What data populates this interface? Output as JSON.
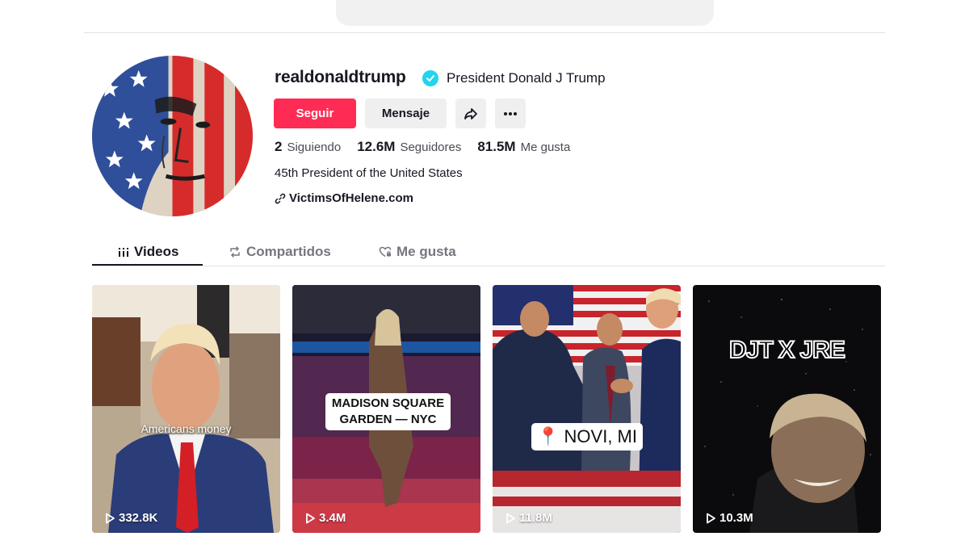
{
  "profile": {
    "username": "realdonaldtrump",
    "nickname": "President Donald J Trump",
    "bio": "45th President of the United States",
    "link": "VictimsOfHelene.com",
    "verified_icon": "verified-check-icon"
  },
  "actions": {
    "follow_label": "Seguir",
    "message_label": "Mensaje",
    "share_icon": "share-icon",
    "more_icon": "more-dots-icon"
  },
  "stats": {
    "following_count": "2",
    "following_label": "Siguiendo",
    "followers_count": "12.6M",
    "followers_label": "Seguidores",
    "likes_count": "81.5M",
    "likes_label": "Me gusta"
  },
  "tabs": [
    {
      "label": "Videos",
      "icon": "grid-icon",
      "active": true
    },
    {
      "label": "Compartidos",
      "icon": "repost-icon",
      "active": false
    },
    {
      "label": "Me gusta",
      "icon": "heart-lock-icon",
      "active": false
    }
  ],
  "videos": [
    {
      "views": "332.8K",
      "caption": "Americans money"
    },
    {
      "views": "3.4M",
      "caption_line1": "MADISON SQUARE",
      "caption_line2": "GARDEN — NYC"
    },
    {
      "views": "11.8M",
      "caption": "NOVI, MI",
      "caption_icon": "location-pin-icon"
    },
    {
      "views": "10.3M",
      "caption": "DJT X JRE"
    }
  ],
  "colors": {
    "accent": "#fe2c55",
    "verified": "#20d5ec",
    "secondary_button": "#efeff0"
  }
}
